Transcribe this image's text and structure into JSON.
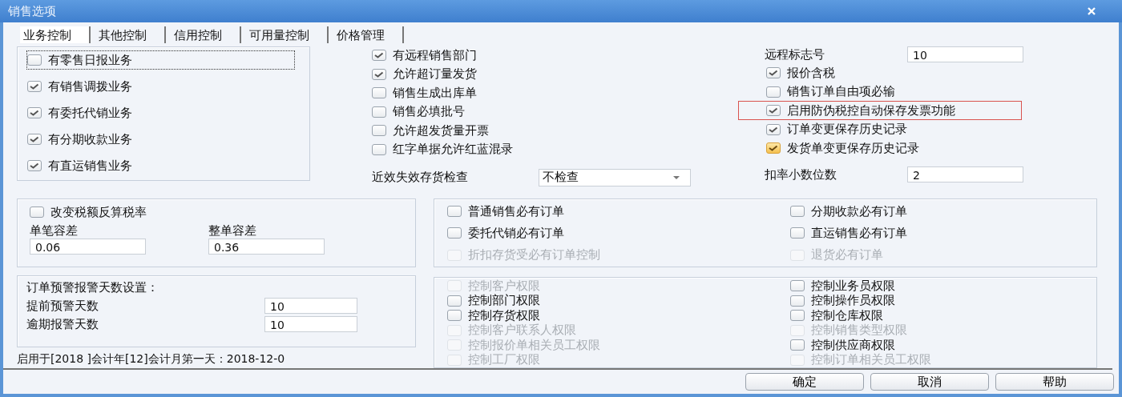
{
  "window": {
    "title": "销售选项"
  },
  "tabs": [
    {
      "label": "业务控制",
      "selected": true
    },
    {
      "label": "其他控制",
      "selected": false
    },
    {
      "label": "信用控制",
      "selected": false
    },
    {
      "label": "可用量控制",
      "selected": false
    },
    {
      "label": "价格管理",
      "selected": false
    }
  ],
  "business_options": [
    {
      "label": "有零售日报业务",
      "checked": false,
      "focused": true
    },
    {
      "label": "有销售调拨业务",
      "checked": true,
      "focused": false
    },
    {
      "label": "有委托代销业务",
      "checked": true,
      "focused": false
    },
    {
      "label": "有分期收款业务",
      "checked": true,
      "focused": false
    },
    {
      "label": "有直运销售业务",
      "checked": true,
      "focused": false
    }
  ],
  "middle_options": [
    {
      "label": "有远程销售部门",
      "checked": true
    },
    {
      "label": "允许超订量发货",
      "checked": true
    },
    {
      "label": "销售生成出库单",
      "checked": false
    },
    {
      "label": "销售必填批号",
      "checked": false
    },
    {
      "label": "允许超发货量开票",
      "checked": false
    },
    {
      "label": "红字单据允许红蓝混录",
      "checked": false
    }
  ],
  "expiry_check": {
    "label": "近效失效存货检查",
    "value": "不检查"
  },
  "remote_flag": {
    "label": "远程标志号",
    "value": "10"
  },
  "right_options": [
    {
      "label": "报价含税",
      "checked": true,
      "hot": false,
      "highlighted": false
    },
    {
      "label": "销售订单自由项必输",
      "checked": false,
      "hot": false,
      "highlighted": false
    },
    {
      "label": "启用防伪税控自动保存发票功能",
      "checked": true,
      "hot": false,
      "highlighted": true
    },
    {
      "label": "订单变更保存历史记录",
      "checked": true,
      "hot": false,
      "highlighted": false
    },
    {
      "label": "发货单变更保存历史记录",
      "checked": true,
      "hot": true,
      "highlighted": false
    }
  ],
  "discount_decimals": {
    "label": "扣率小数位数",
    "value": "2"
  },
  "tax_group": {
    "option": {
      "label": "改变税额反算税率",
      "checked": false
    },
    "fields": [
      {
        "label": "单笔容差",
        "value": "0.06"
      },
      {
        "label": "整单容差",
        "value": "0.36"
      }
    ]
  },
  "alert_group": {
    "title": "订单预警报警天数设置：",
    "fields": [
      {
        "label": "提前预警天数",
        "value": "10"
      },
      {
        "label": "逾期报警天数",
        "value": "10"
      }
    ]
  },
  "footer_text": "启用于[2018 ]会计年[12]会计月第一天：2018-12-0",
  "order_required": [
    {
      "label": "普通销售必有订单",
      "checked": false,
      "disabled": false
    },
    {
      "label": "分期收款必有订单",
      "checked": false,
      "disabled": false
    },
    {
      "label": "委托代销必有订单",
      "checked": false,
      "disabled": false
    },
    {
      "label": "直运销售必有订单",
      "checked": false,
      "disabled": false
    },
    {
      "label": "折扣存货受必有订单控制",
      "checked": false,
      "disabled": true
    },
    {
      "label": "退货必有订单",
      "checked": false,
      "disabled": true
    }
  ],
  "permissions": [
    {
      "label": "控制客户权限",
      "checked": false,
      "disabled": true
    },
    {
      "label": "控制业务员权限",
      "checked": false,
      "disabled": false
    },
    {
      "label": "控制部门权限",
      "checked": false,
      "disabled": false
    },
    {
      "label": "控制操作员权限",
      "checked": false,
      "disabled": false
    },
    {
      "label": "控制存货权限",
      "checked": false,
      "disabled": false
    },
    {
      "label": "控制仓库权限",
      "checked": false,
      "disabled": false
    },
    {
      "label": "控制客户联系人权限",
      "checked": false,
      "disabled": true
    },
    {
      "label": "控制销售类型权限",
      "checked": false,
      "disabled": true
    },
    {
      "label": "控制报价单相关员工权限",
      "checked": false,
      "disabled": true
    },
    {
      "label": "控制供应商权限",
      "checked": false,
      "disabled": false
    },
    {
      "label": "控制工厂权限",
      "checked": false,
      "disabled": true
    },
    {
      "label": "控制订单相关员工权限",
      "checked": false,
      "disabled": true
    }
  ],
  "buttons": [
    "确定",
    "取消",
    "帮助"
  ]
}
